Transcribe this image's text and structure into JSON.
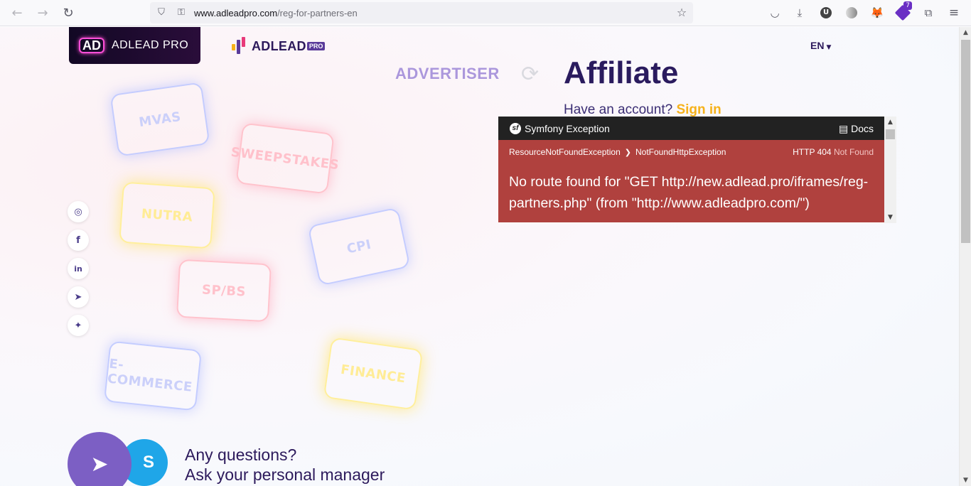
{
  "browser": {
    "url_host": "www.adleadpro.com",
    "url_path": "/reg-for-partners-en",
    "extension_badge": "7",
    "icons": [
      "back-icon",
      "forward-icon",
      "reload-icon",
      "shield-icon",
      "lock-icon",
      "star-icon",
      "pocket-icon",
      "download-icon",
      "ublock-icon",
      "extension-icon",
      "metamask-icon",
      "extension-badge-icon",
      "puzzle-icon",
      "menu-icon"
    ]
  },
  "header": {
    "logo_dark_mark": "AD",
    "logo_dark_text": "ADLEAD PRO",
    "logo_light_text": "ADLEAD",
    "logo_light_badge": "PRO",
    "language": "EN"
  },
  "roles": {
    "advertiser": "ADVERTISER",
    "affiliate": "Affiliate"
  },
  "account": {
    "prompt": "Have an account?",
    "signin": "Sign in"
  },
  "tags": [
    "MVAS",
    "SWEEPSTAKES",
    "NUTRA",
    "CPI",
    "SP/BS",
    "E-COMMERCE",
    "FINANCE"
  ],
  "social": [
    "instagram-icon",
    "facebook-icon",
    "linkedin-icon",
    "telegram-icon",
    "twitter-icon"
  ],
  "contact": {
    "line1": "Any questions?",
    "line2": "Ask your personal manager"
  },
  "error": {
    "header_title": "Symfony Exception",
    "docs": "Docs",
    "exception1": "ResourceNotFoundException",
    "exception2": "NotFoundHttpException",
    "status_code": "HTTP 404",
    "status_text": "Not Found",
    "message": "No route found for \"GET http://new.adlead.pro/iframes/reg-partners.php\" (from \"http://www.adleadpro.com/\")"
  },
  "colors": {
    "brand_dark": "#2a1b5e",
    "accent_yellow": "#f6b21b",
    "error_red": "#b0413e",
    "telegram_purple": "#7c5fc4",
    "skype_blue": "#1fa6e8"
  }
}
